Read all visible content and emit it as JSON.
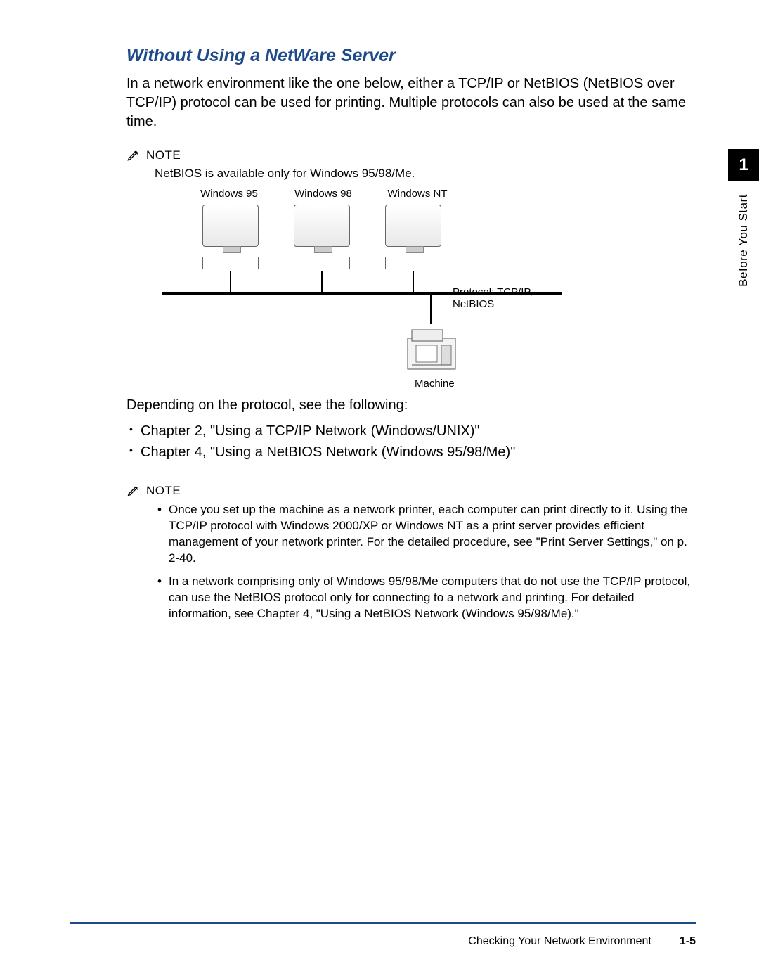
{
  "heading": "Without Using a NetWare Server",
  "intro": "In a network environment like the one below, either a TCP/IP or NetBIOS (NetBIOS over TCP/IP) protocol can be used for printing. Multiple protocols can also be used at the same time.",
  "note1_label": "NOTE",
  "note1_text": "NetBIOS is available only for Windows 95/98/Me.",
  "diagram": {
    "os": [
      "Windows 95",
      "Windows 98",
      "Windows NT"
    ],
    "protocol": "Protocol: TCP/IP, NetBIOS",
    "machine": "Machine"
  },
  "depending": "Depending on the protocol, see the following:",
  "chapter_bullets": [
    "Chapter 2, \"Using a TCP/IP Network (Windows/UNIX)\"",
    "Chapter 4, \"Using a NetBIOS Network (Windows 95/98/Me)\""
  ],
  "note2_label": "NOTE",
  "note2_bullets": [
    "Once you set up the machine as a network printer, each computer can print directly to it. Using the TCP/IP protocol with Windows 2000/XP or Windows NT as a print server provides efficient management of your network printer.  For the detailed procedure, see \"Print Server Settings,\" on p. 2-40.",
    "In a network comprising only of Windows 95/98/Me computers that do not use the TCP/IP protocol, can use the NetBIOS protocol only for connecting to a network and printing. For detailed information, see Chapter 4, \"Using a NetBIOS Network (Windows 95/98/Me).\""
  ],
  "sidebar": {
    "chapter": "1",
    "title": "Before You Start"
  },
  "footer": {
    "section": "Checking Your Network Environment",
    "page": "1-5"
  }
}
